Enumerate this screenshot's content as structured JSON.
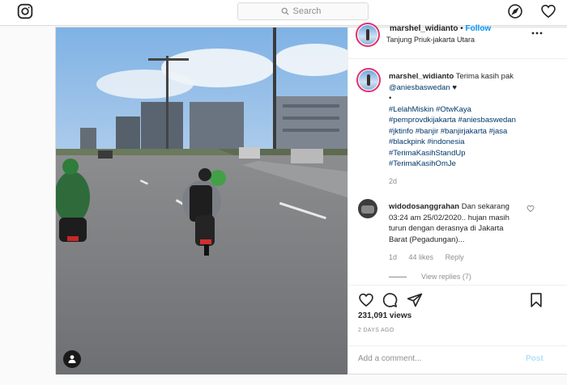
{
  "nav": {
    "search_placeholder": "Search",
    "icons": {
      "logo": "instagram-icon",
      "search": "search-icon",
      "explore": "compass-icon",
      "activity": "heart-icon"
    }
  },
  "post": {
    "username": "marshel_widianto",
    "separator": "•",
    "follow_label": "Follow",
    "location": "Tanjung Priuk-jakarta Utara",
    "caption": {
      "username": "marshel_widianto",
      "text": "Terima kasih pak",
      "mention": "@aniesbaswedan",
      "heart": "♥",
      "bullet": "•",
      "hashtag_lines": [
        "#LelahMiskin #OtwKaya",
        "#pemprovdkijakarta #aniesbaswedan",
        "#jktinfo #banjir #banjirjakarta #jasa",
        "#blackpink #indonesia",
        "#TerimaKasihStandUp",
        "#TerimaKasihOmJe"
      ],
      "time": "2d"
    },
    "comment": {
      "username": "widodosanggrahan",
      "text": "Dan sekarang 03:24 am 25/02/2020.. hujan masih turun dengan derasnya di Jakarta Barat (Pegadungan)...",
      "time": "1d",
      "likes": "44 likes",
      "reply_label": "Reply",
      "view_replies": "View replies (7)"
    },
    "views": "231,091 views",
    "posted": "2 DAYS AGO",
    "add_comment_placeholder": "Add a comment...",
    "post_label": "Post"
  },
  "colors": {
    "link_blue": "#0095f6",
    "hashtag": "#00376b",
    "muted": "#8e8e8e",
    "post_disabled": "#b2dffc"
  }
}
